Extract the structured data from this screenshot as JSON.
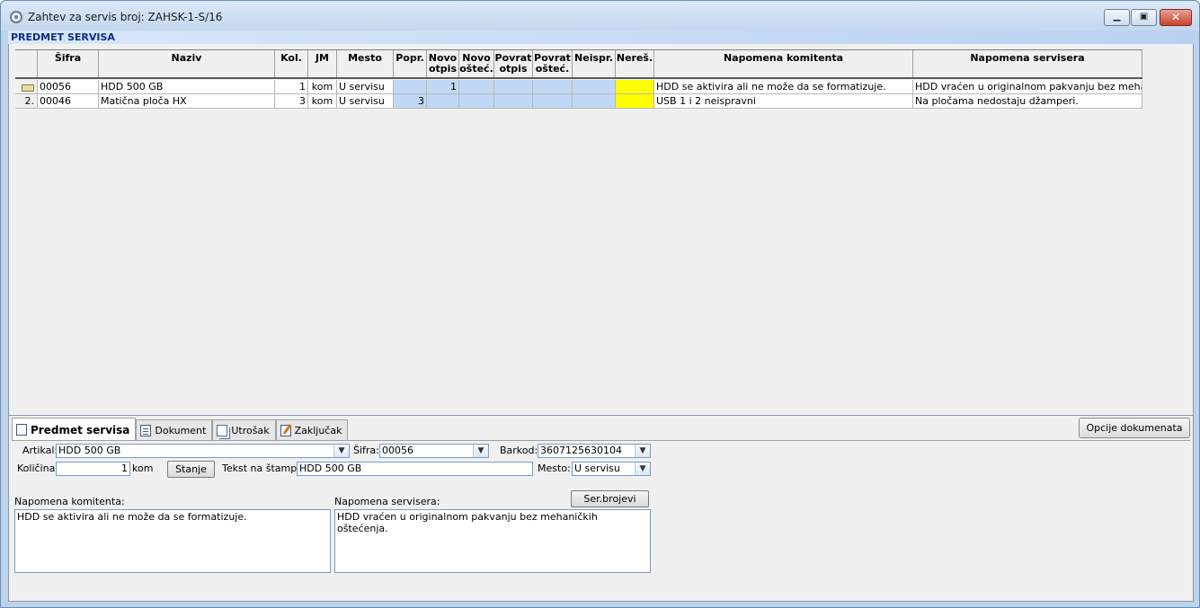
{
  "window": {
    "title": "Zahtev za servis broj: ZAHSK-1-S/16",
    "min_label": "▁",
    "max_label": "▣",
    "close_label": "✕"
  },
  "section_header": "PREDMET SERVISA",
  "grid": {
    "columns": [
      "",
      "Šifra",
      "Naziv",
      "Kol.",
      "JM",
      "Mesto",
      "Popr.",
      "Novo\notpis",
      "Novo\nošteć.",
      "Povrat\notpis",
      "Povrat\nošteć.",
      "Neispr.",
      "Nereš.",
      "Napomena komitenta",
      "Napomena servisera"
    ],
    "rows": [
      {
        "indicator": "",
        "sifra": "00056",
        "naziv": "HDD 500 GB",
        "kol": "1",
        "jm": "kom",
        "mesto": "U servisu",
        "popr": "",
        "novo_otpis": "1",
        "novo_ostec": "",
        "povrat_otpis": "",
        "povrat_ostec": "",
        "neispr": "",
        "neres": "",
        "napomena_komitenta": "HDD se aktivira ali ne može da se formatizuje.",
        "napomena_servisera": "HDD vraćen u originalnom pakvanju bez mehaničkih o"
      },
      {
        "indicator": "2.",
        "sifra": "00046",
        "naziv": "Matična ploča HX",
        "kol": "3",
        "jm": "kom",
        "mesto": "U servisu",
        "popr": "3",
        "novo_otpis": "",
        "novo_ostec": "",
        "povrat_otpis": "",
        "povrat_ostec": "",
        "neispr": "",
        "neres": "",
        "napomena_komitenta": "USB 1 i 2 neispravni",
        "napomena_servisera": "Na pločama nedostaju džamperi."
      }
    ]
  },
  "tabs": [
    "Predmet servisa",
    "Dokument",
    "Utrošak",
    "Zaključak"
  ],
  "opcije_button": "Opcije dokumenata",
  "form": {
    "artikal_label": "Artikal:",
    "artikal_value": "HDD 500 GB",
    "sifra_label": "Šifra:",
    "sifra_value": "00056",
    "barkod_label": "Barkod:",
    "barkod_value": "3607125630104",
    "kolicina_label": "Količina:",
    "kolicina_value": "1",
    "kolicina_unit": "kom",
    "stanje_button": "Stanje",
    "tekst_label": "Tekst na štampi:",
    "tekst_value": "HDD 500 GB",
    "mesto_label": "Mesto:",
    "mesto_value": "U servisu",
    "ser_brojevi_button": "Ser.brojevi",
    "napomena_komitenta_label": "Napomena komitenta:",
    "napomena_komitenta_value": "HDD se aktivira ali ne može da se formatizuje.",
    "napomena_servisera_label": "Napomena servisera:",
    "napomena_servisera_value": "HDD vraćen u originalnom pakvanju bez mehaničkih oštećenja."
  },
  "colors": {
    "cell_blue": "#c0d8f5",
    "cell_yellow": "#ffff00",
    "header_text": "#0b2e8c",
    "close_button": "#c8412d"
  }
}
